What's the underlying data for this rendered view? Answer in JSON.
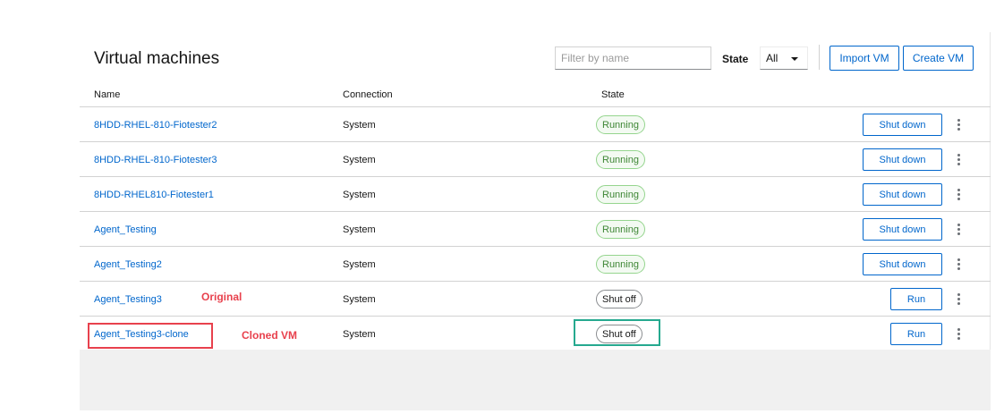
{
  "header": {
    "title": "Virtual machines",
    "filter_placeholder": "Filter by name",
    "state_label": "State",
    "state_value": "All",
    "import_label": "Import VM",
    "create_label": "Create VM"
  },
  "table": {
    "columns": [
      "Name",
      "Connection",
      "State"
    ],
    "rows": [
      {
        "name": "8HDD-RHEL-810-Fiotester2",
        "connection": "System",
        "state": "Running",
        "action": "Shut down"
      },
      {
        "name": "8HDD-RHEL-810-Fiotester3",
        "connection": "System",
        "state": "Running",
        "action": "Shut down"
      },
      {
        "name": "8HDD-RHEL810-Fiotester1",
        "connection": "System",
        "state": "Running",
        "action": "Shut down"
      },
      {
        "name": "Agent_Testing",
        "connection": "System",
        "state": "Running",
        "action": "Shut down"
      },
      {
        "name": "Agent_Testing2",
        "connection": "System",
        "state": "Running",
        "action": "Shut down"
      },
      {
        "name": "Agent_Testing3",
        "connection": "System",
        "state": "Shut off",
        "action": "Run"
      },
      {
        "name": "Agent_Testing3-clone",
        "connection": "System",
        "state": "Shut off",
        "action": "Run"
      }
    ]
  },
  "annotations": {
    "original": "Original",
    "cloned": "Cloned VM"
  },
  "colors": {
    "link": "#0066cc",
    "running_green": "#3e8635",
    "annotation_red": "#e8414d",
    "annotation_green": "#26a98f"
  }
}
